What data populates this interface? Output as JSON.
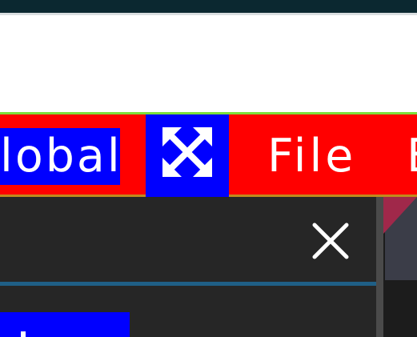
{
  "menubar": {
    "global_label": "lobal",
    "file_label": "File",
    "edit_label": "E"
  },
  "icons": {
    "maximize": "maximize-arrows-icon",
    "close": "close-icon"
  },
  "colors": {
    "titlebar": "#0b2830",
    "menubar_background": "#ff0000",
    "selection_highlight": "#0000ff",
    "menubar_top_border": "#7dde3a",
    "menubar_bottom_border": "#c08a1c",
    "panel_background": "#262626",
    "search_underline": "#1f5f86",
    "right_pane_accent": "#a0284a"
  }
}
